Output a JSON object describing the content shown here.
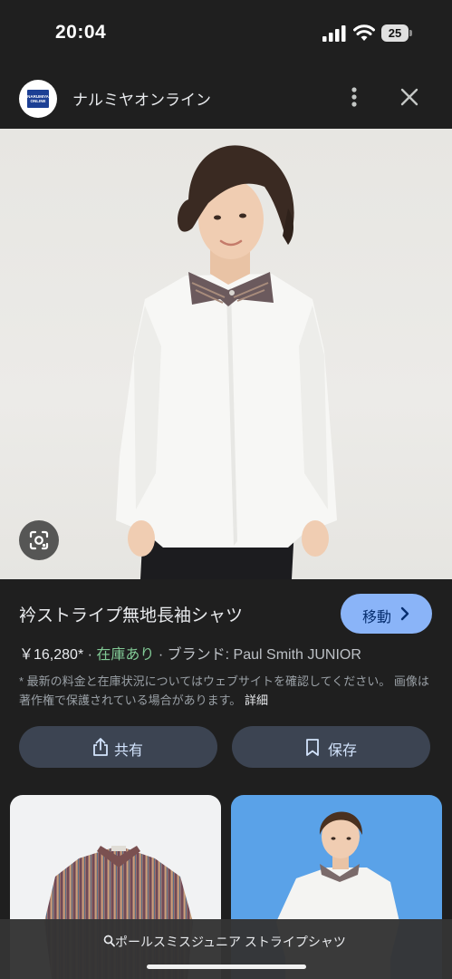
{
  "status_bar": {
    "time": "20:04",
    "battery": "25"
  },
  "header": {
    "site_name": "ナルミヤオンライン",
    "logo_text": "NARUMIYA ONLINE"
  },
  "product": {
    "title": "衿ストライプ無地長袖シャツ",
    "visit_label": "移動",
    "price": "￥16,280*",
    "stock": "在庫あり",
    "brand": "ブランド: Paul Smith JUNIOR",
    "disclaimer": "* 最新の料金と在庫状況についてはウェブサイトを確認してください。 画像は著作権で保護されている場合があります。",
    "disclaimer_more": "詳細"
  },
  "actions": {
    "share_label": "共有",
    "save_label": "保存"
  },
  "search": {
    "query": "ポールスミスジュニア ストライプシャツ"
  },
  "icons": [
    "signal-icon",
    "wifi-icon",
    "battery-icon",
    "more-vert-icon",
    "close-icon",
    "lens-icon",
    "chevron-right-icon",
    "share-icon",
    "bookmark-icon",
    "search-icon"
  ],
  "colors": {
    "background": "#1f1f1f",
    "accent": "#8ab4f8",
    "stock": "#81c995",
    "button": "#3c4452"
  }
}
